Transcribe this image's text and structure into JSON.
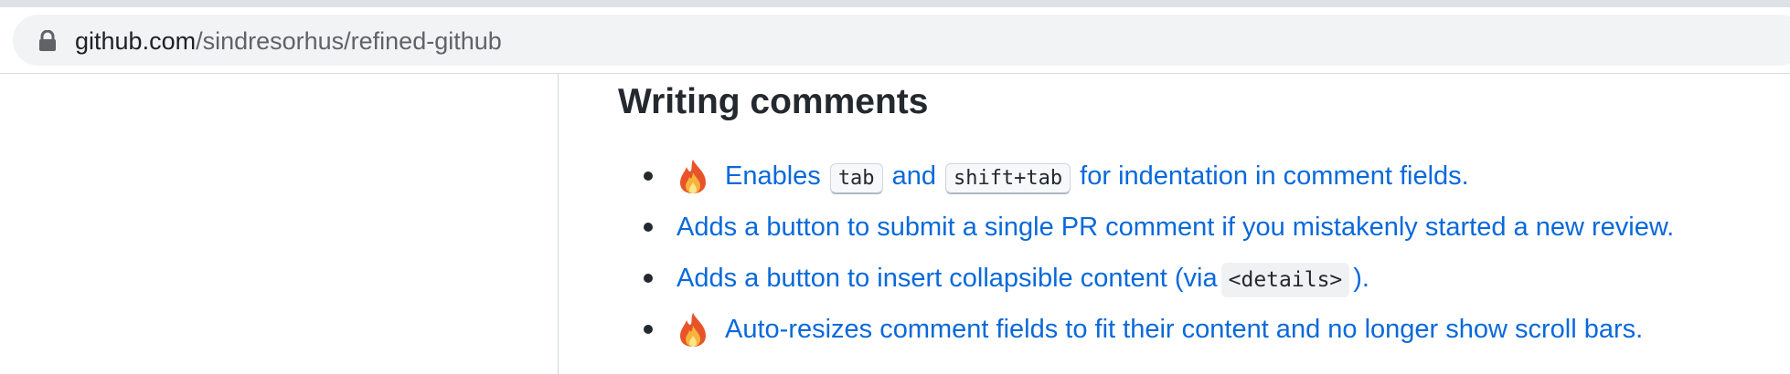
{
  "browser": {
    "url_domain": "github.com",
    "url_path": "/sindresorhus/refined-github"
  },
  "content": {
    "heading": "Writing comments",
    "features": [
      {
        "icon": "fire-icon",
        "parts": [
          {
            "type": "text",
            "value": "Enables"
          },
          {
            "type": "kbd",
            "value": "tab"
          },
          {
            "type": "text",
            "value": "and"
          },
          {
            "type": "kbd",
            "value": "shift+tab"
          },
          {
            "type": "text",
            "value": "for indentation in comment fields."
          }
        ]
      },
      {
        "icon": null,
        "parts": [
          {
            "type": "text",
            "value": "Adds a button to submit a single PR comment if you mistakenly started a new review."
          }
        ]
      },
      {
        "icon": null,
        "parts": [
          {
            "type": "text",
            "value": "Adds a button to insert collapsible content (via"
          },
          {
            "type": "code",
            "value": "<details>"
          },
          {
            "type": "text",
            "value": ")."
          }
        ]
      },
      {
        "icon": "fire-icon",
        "parts": [
          {
            "type": "text",
            "value": "Auto-resizes comment fields to fit their content and no longer show scroll bars."
          }
        ]
      }
    ]
  },
  "colors": {
    "link": "#0969da",
    "text": "#24292f",
    "address_bar": "#f1f3f4"
  }
}
